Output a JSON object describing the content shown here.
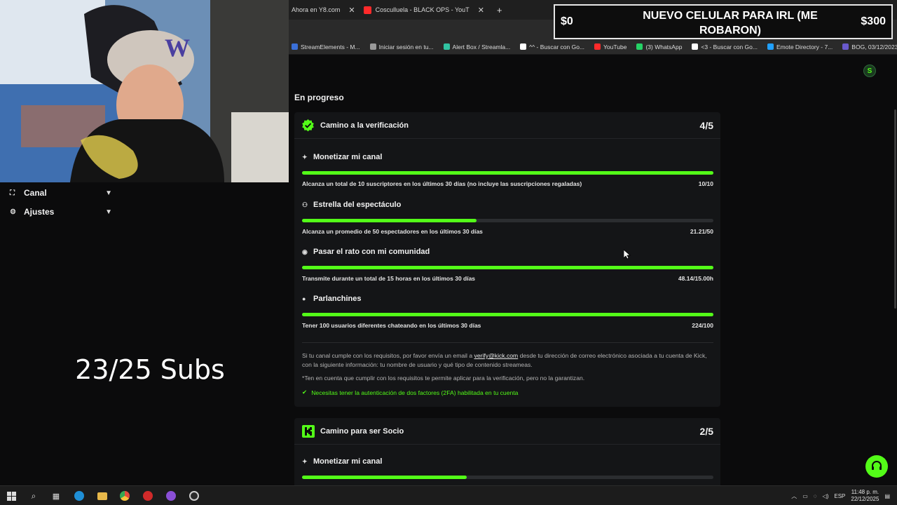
{
  "browser": {
    "tabs": [
      {
        "label": "Ahora en Y8.com",
        "color": "#1f1f1f",
        "active": false
      },
      {
        "label": "Cosculluela - BLACK OPS - YouT",
        "color": "#ff2a2a",
        "active": false
      }
    ],
    "bookmarks": [
      {
        "label": "StreamElements - M...",
        "color": "#3a6fd8"
      },
      {
        "label": "Iniciar sesión en tu...",
        "color": "#9a9a9a"
      },
      {
        "label": "Alert Box / Streamla...",
        "color": "#31c3a2"
      },
      {
        "label": "^^ - Buscar con Go...",
        "color": "#ffffff"
      },
      {
        "label": "YouTube",
        "color": "#ff2a2a"
      },
      {
        "label": "(3) WhatsApp",
        "color": "#25d366"
      },
      {
        "label": "<3 - Buscar con Go...",
        "color": "#ffffff"
      },
      {
        "label": "Emote Directory - 7...",
        "color": "#20a0ff"
      },
      {
        "label": "BOG, 03/12/2023",
        "color": "#6a5acd"
      }
    ],
    "bookmarks_more": "»"
  },
  "overlay": {
    "goal_start": "$0",
    "goal_end": "$300",
    "goal_title": "NUEVO CELULAR PARA IRL (ME ROBARON)",
    "subs_text": "23/25 Subs"
  },
  "sidebar": {
    "items": [
      {
        "label": "Canal",
        "icon": "channel-icon"
      },
      {
        "label": "Ajustes",
        "icon": "gear-icon"
      }
    ]
  },
  "main": {
    "section_title": "En progreso",
    "verification": {
      "title": "Camino a la verificación",
      "count": "4/5",
      "requirements": [
        {
          "title": "Monetizar mi canal",
          "icon": "sparkle-icon",
          "desc": "Alcanza un total de 10 suscriptores en los últimos 30 días (no incluye las suscripciones regaladas)",
          "value": "10/10",
          "progress": 1.0
        },
        {
          "title": "Estrella del espectáculo",
          "icon": "users-icon",
          "desc": "Alcanza un promedio de 50 espectadores en los últimos 30 días",
          "value": "21.21/50",
          "progress": 0.4242
        },
        {
          "title": "Pasar el rato con mi comunidad",
          "icon": "broadcast-icon",
          "desc": "Transmite durante un total de 15 horas en los últimos 30 días",
          "value": "48.14/15.00h",
          "progress": 1.0
        },
        {
          "title": "Parlanchines",
          "icon": "chat-icon",
          "desc": "Tener 100 usuarios diferentes chateando en los últimos 30 días",
          "value": "224/100",
          "progress": 1.0
        }
      ],
      "info_before_link": "Si tu canal cumple con los requisitos, por favor envía un email a",
      "info_link": "verify@kick.com",
      "info_after_link": "desde tu dirección de correo electrónico asociada a tu cuenta de Kick, con la siguiente información: tu nombre de usuario y qué tipo de contenido streameas.",
      "note": "*Ten en cuenta que cumplir con los requisitos te permite aplicar para la verificación, pero no la garantizan.",
      "twofa": "Necesitas tener la autenticación de dos factores (2FA) habilitada en tu cuenta"
    },
    "partner": {
      "title": "Camino para ser Socio",
      "count": "2/5",
      "requirements": [
        {
          "title": "Monetizar mi canal",
          "icon": "sparkle-icon",
          "progress": 0.4
        }
      ]
    }
  },
  "taskbar": {
    "language": "ESP",
    "time": "11:48 p. m.",
    "date": "22/12/2025"
  },
  "colors": {
    "accent": "#53fc18",
    "card": "#141517",
    "background": "#0b0b0c"
  }
}
